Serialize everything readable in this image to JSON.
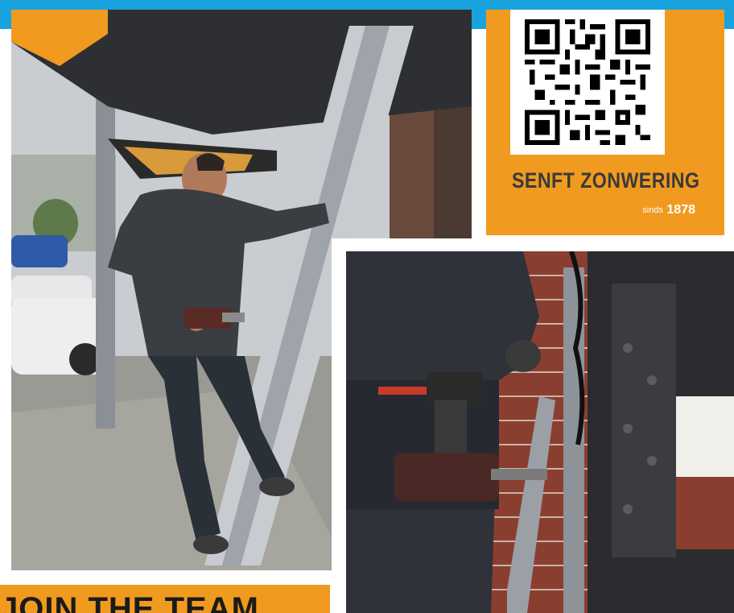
{
  "brand": {
    "name": "SENFT ZONWERING",
    "since_word": "sinds",
    "since_year": "1878"
  },
  "banner": {
    "text": "JOIN THE TEAM"
  },
  "colors": {
    "accent_orange": "#f09a1f",
    "top_stripe_blue": "#19a3de",
    "brand_text": "#3a3a3a"
  },
  "images": {
    "photo_left": "worker-on-ladder-photo",
    "photo_right": "drill-closeup-photo",
    "qr": "qr-code"
  }
}
